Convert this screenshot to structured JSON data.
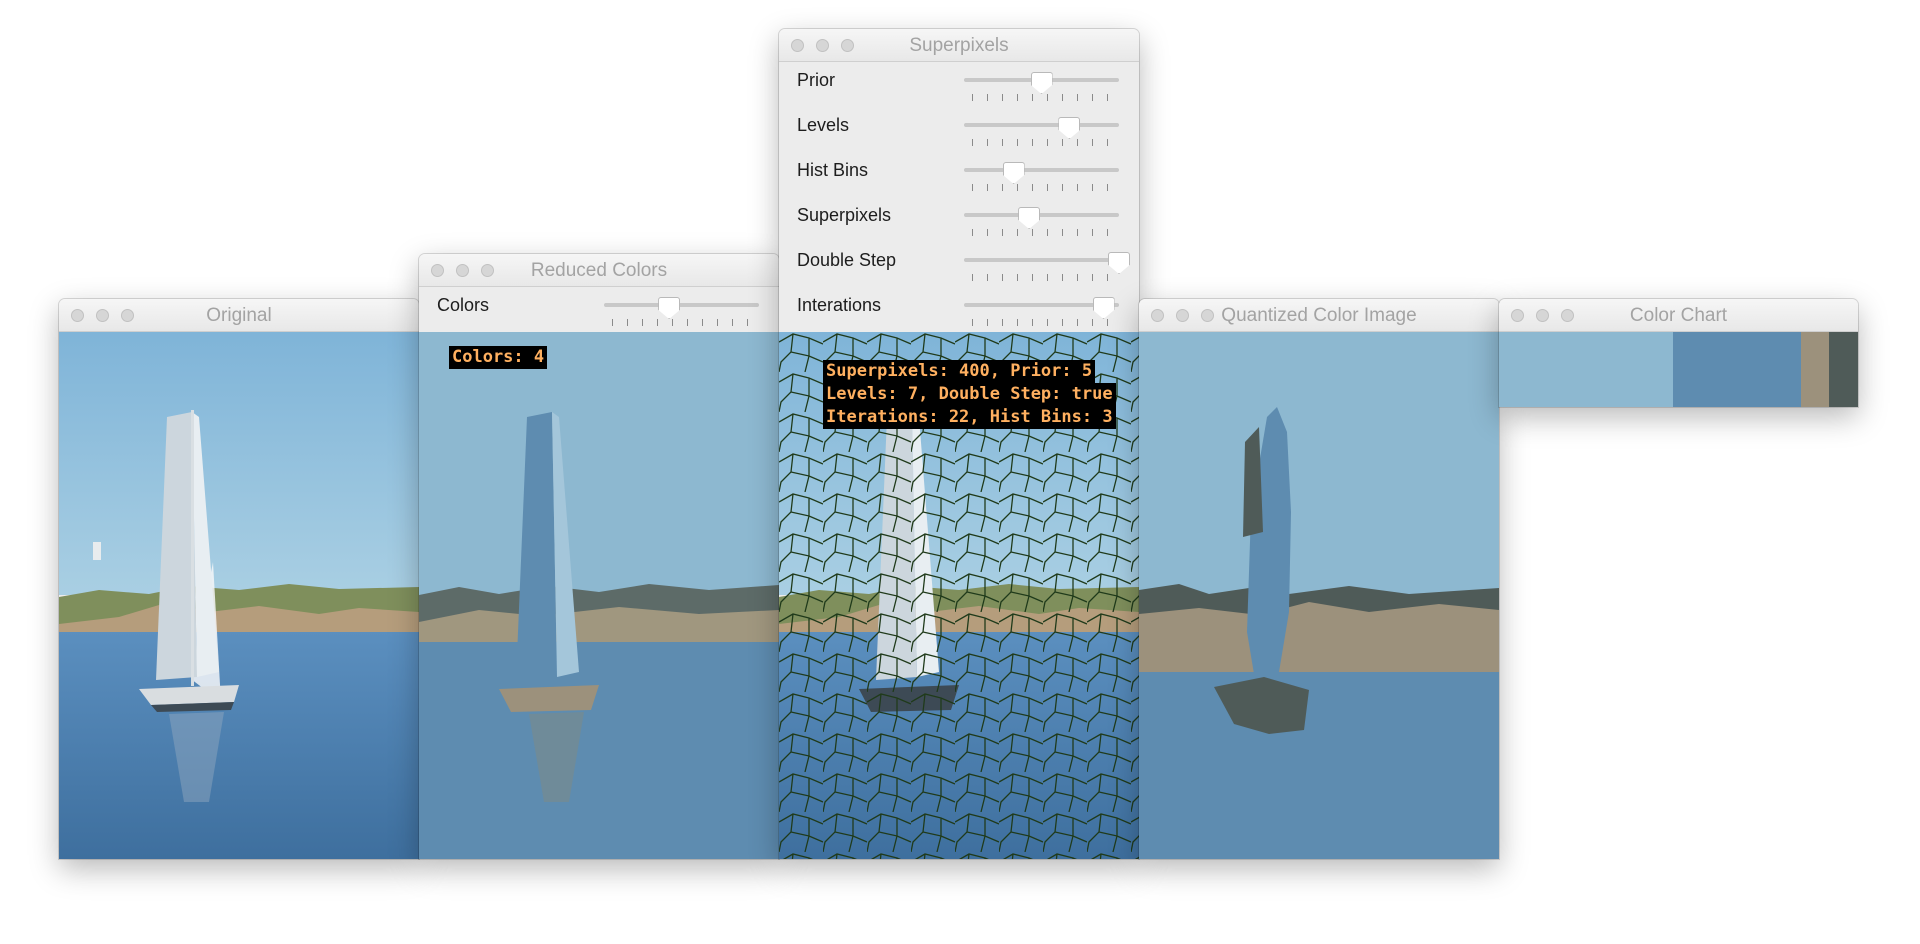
{
  "windows": {
    "original": {
      "title": "Original"
    },
    "reduced": {
      "title": "Reduced Colors",
      "slider_label": "Colors",
      "slider_value": 0.42,
      "overlay_text": "Colors: 4"
    },
    "superpixels": {
      "title": "Superpixels",
      "sliders": [
        {
          "label": "Prior",
          "value": 0.5
        },
        {
          "label": "Levels",
          "value": 0.68
        },
        {
          "label": "Hist Bins",
          "value": 0.32
        },
        {
          "label": "Superpixels",
          "value": 0.42
        },
        {
          "label": "Double Step",
          "value": 1.0
        },
        {
          "label": "Interations",
          "value": 0.9
        }
      ],
      "overlay_lines": [
        "Superpixels: 400, Prior: 5",
        "Levels: 7, Double Step: true",
        "Iterations: 22, Hist Bins: 3"
      ]
    },
    "quantized": {
      "title": "Quantized Color Image"
    },
    "colorchart": {
      "title": "Color Chart",
      "swatches": [
        {
          "color": "#8db8d0",
          "fraction": 0.485
        },
        {
          "color": "#5e8cb0",
          "fraction": 0.355
        },
        {
          "color": "#9c917c",
          "fraction": 0.08
        },
        {
          "color": "#4f5b58",
          "fraction": 0.08
        }
      ]
    }
  }
}
